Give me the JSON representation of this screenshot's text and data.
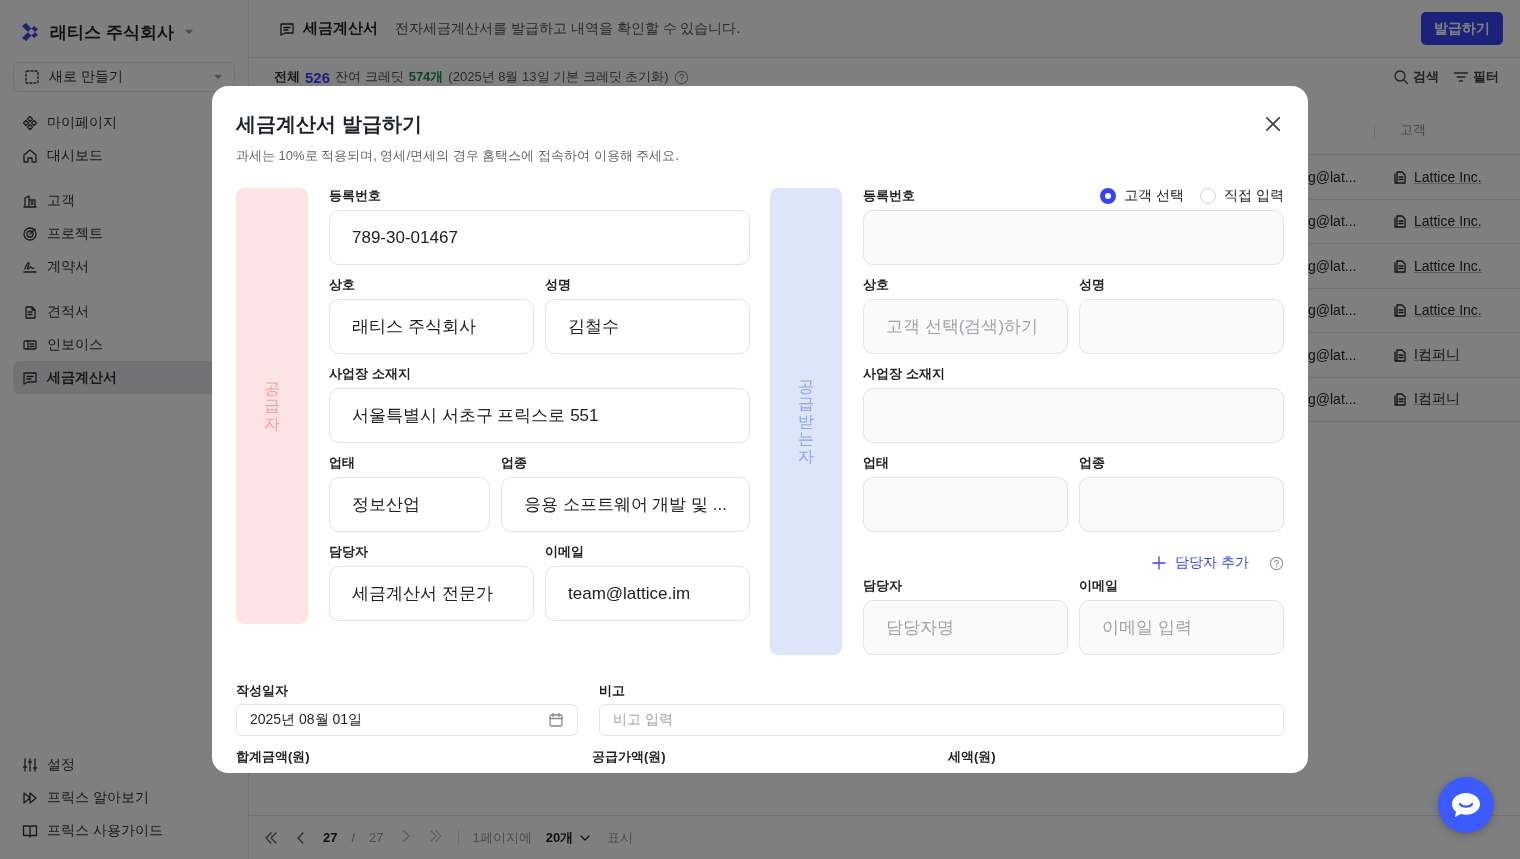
{
  "sidebar": {
    "company": "래티스 주식회사",
    "new_button": "새로 만들기",
    "groups": [
      [
        {
          "label": "마이페이지",
          "selected": false
        },
        {
          "label": "대시보드",
          "selected": false
        }
      ],
      [
        {
          "label": "고객",
          "selected": false
        },
        {
          "label": "프로젝트",
          "selected": false
        },
        {
          "label": "계약서",
          "selected": false
        }
      ],
      [
        {
          "label": "견적서",
          "selected": false
        },
        {
          "label": "인보이스",
          "selected": false
        },
        {
          "label": "세금계산서",
          "selected": true
        }
      ]
    ],
    "footer": [
      {
        "label": "설정"
      },
      {
        "label": "프릭스 알아보기"
      },
      {
        "label": "프릭스 사용가이드"
      }
    ]
  },
  "header": {
    "title": "세금계산서",
    "description": "전자세금계산서를 발급하고 내역을 확인할 수 있습니다.",
    "primary_button": "발급하기"
  },
  "summary": {
    "total_label": "전체",
    "total": "526",
    "credit_label": "잔여 크레딧",
    "credit": "574개",
    "note": "(2025년 8월 13일 기본 크레딧 초기화)"
  },
  "toolbar": {
    "search": "검색",
    "filter": "필터"
  },
  "table": {
    "columns": [
      "고객"
    ],
    "rows": [
      {
        "email": "g@lat...",
        "customer": "Lattice Inc."
      },
      {
        "email": "g@lat...",
        "customer": "Lattice Inc."
      },
      {
        "email": "g@lat...",
        "customer": "Lattice Inc."
      },
      {
        "email": "g@lat...",
        "customer": "Lattice Inc."
      },
      {
        "email": "g@lat...",
        "customer": "I컴퍼니"
      },
      {
        "email": "g@lat...",
        "customer": "I컴퍼니"
      }
    ]
  },
  "pagination": {
    "current": "27",
    "separator": "/",
    "total": "27",
    "per_page_label": "1페이지에",
    "per_page": "20개",
    "suffix": "표시"
  },
  "modal": {
    "title": "세금계산서 발급하기",
    "description": "과세는 10%로 적용되며, 영세/면세의 경우 홈택스에 접속하여 이용해 주세요.",
    "supplier": {
      "side_label": "공급자",
      "rows": [
        [
          {
            "label": "등록번호",
            "value": "789-30-01467"
          }
        ],
        [
          {
            "label": "상호",
            "value": "래티스 주식회사"
          },
          {
            "label": "성명",
            "value": "김철수"
          }
        ],
        [
          {
            "label": "사업장 소재지",
            "value": "서울특별시 서초구 프릭스로 551"
          }
        ],
        [
          {
            "label": "업태",
            "value": "정보산업"
          },
          {
            "label": "업종",
            "value": "응용 소프트웨어 개발 및 ..."
          }
        ],
        [
          {
            "label": "담당자",
            "value": "세금계산서 전문가"
          },
          {
            "label": "이메일",
            "value": "team@lattice.im"
          }
        ]
      ]
    },
    "recipient": {
      "side_label": "공급받는자",
      "options": [
        {
          "label": "고객 선택",
          "selected": true
        },
        {
          "label": "직접 입력",
          "selected": false
        }
      ],
      "rows": [
        [
          {
            "label": "등록번호"
          }
        ],
        [
          {
            "label": "상호",
            "placeholder": "고객 선택(검색)하기"
          },
          {
            "label": "성명"
          }
        ],
        [
          {
            "label": "사업장 소재지"
          }
        ],
        [
          {
            "label": "업태"
          },
          {
            "label": "업종"
          }
        ]
      ],
      "add_contact": "담당자 추가",
      "contact_row": [
        {
          "label": "담당자",
          "placeholder": "담당자명"
        },
        {
          "label": "이메일",
          "placeholder": "이메일 입력"
        }
      ]
    },
    "date": {
      "label": "작성일자",
      "value": "2025년 08월 01일"
    },
    "memo": {
      "label": "비고",
      "placeholder": "비고 입력"
    },
    "amounts": [
      "합계금액(원)",
      "공급가액(원)",
      "세액(원)"
    ]
  }
}
